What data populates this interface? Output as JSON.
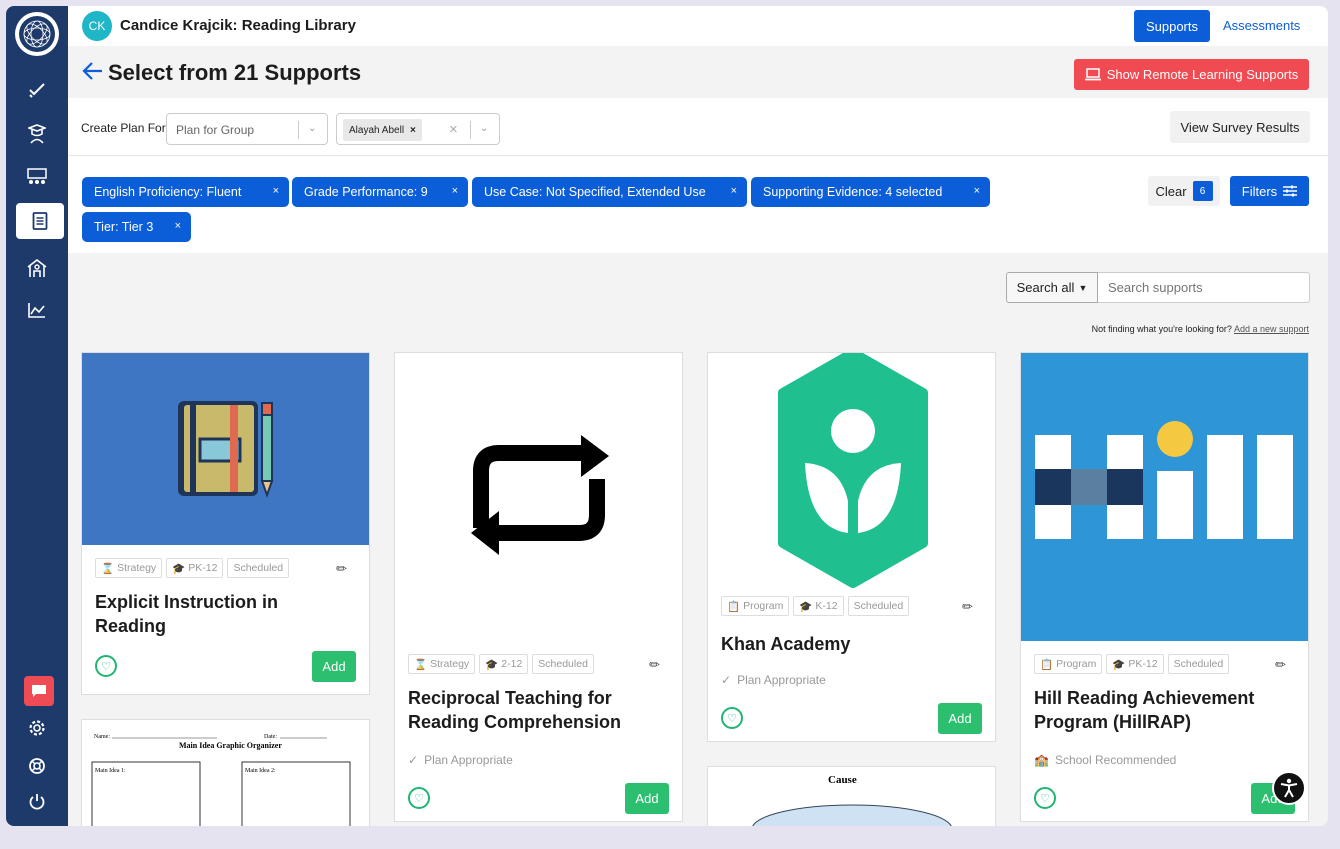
{
  "header": {
    "avatar_initials": "CK",
    "title": "Candice Krajcik: Reading Library",
    "tab_supports": "Supports",
    "tab_assessments": "Assessments"
  },
  "page": {
    "title": "Select from 21 Supports",
    "remote_button": "Show Remote Learning Supports"
  },
  "plan": {
    "label": "Create Plan For",
    "group_placeholder": "Plan for Group",
    "student_chip": "Alayah Abell",
    "survey_button": "View Survey Results"
  },
  "filters": {
    "chips": [
      "English Proficiency: Fluent",
      "Grade Performance: 9",
      "Use Case: Not Specified, Extended Use",
      "Supporting Evidence: 4 selected",
      "Tier: Tier 3"
    ],
    "clear_label": "Clear",
    "clear_count": "6",
    "filters_label": "Filters"
  },
  "search": {
    "scope": "Search all",
    "placeholder": "Search supports",
    "not_finding": "Not finding what you're looking for?",
    "add_link": "Add a new support"
  },
  "cards": [
    {
      "title_line1": "Explicit Instruction in",
      "title_line2": "Reading",
      "type": "Strategy",
      "grades": "PK-12",
      "schedule": "Scheduled",
      "add": "Add"
    },
    {
      "title_line1": "Reciprocal Teaching for",
      "title_line2": "Reading Comprehension",
      "type": "Strategy",
      "grades": "2-12",
      "schedule": "Scheduled",
      "status": "Plan Appropriate",
      "add": "Add"
    },
    {
      "title_line1": "Khan Academy",
      "type": "Program",
      "grades": "K-12",
      "schedule": "Scheduled",
      "status": "Plan Appropriate",
      "add": "Add"
    },
    {
      "title_line1": "Hill Reading Achievement",
      "title_line2": "Program (HillRAP)",
      "type": "Program",
      "grades": "PK-12",
      "schedule": "Scheduled",
      "status": "School Recommended",
      "add": "Add"
    }
  ],
  "organizer": {
    "name": "Name:",
    "date": "Date:",
    "title": "Main Idea Graphic Organizer",
    "idea1": "Main Idea 1:",
    "idea2": "Main Idea 2:"
  },
  "cause_label": "Cause",
  "colors": {
    "sidebar": "#1d3a6b",
    "primary": "#0b5ed7",
    "danger": "#f04a52",
    "success": "#2cbf6f",
    "khan": "#1fbf8f",
    "hill": "#2e95d6"
  },
  "icons": [
    "check-icon",
    "graduate-icon",
    "classroom-icon",
    "book-icon",
    "school-icon",
    "chart-icon",
    "chat-icon",
    "gear-icon",
    "help-icon",
    "power-icon"
  ]
}
